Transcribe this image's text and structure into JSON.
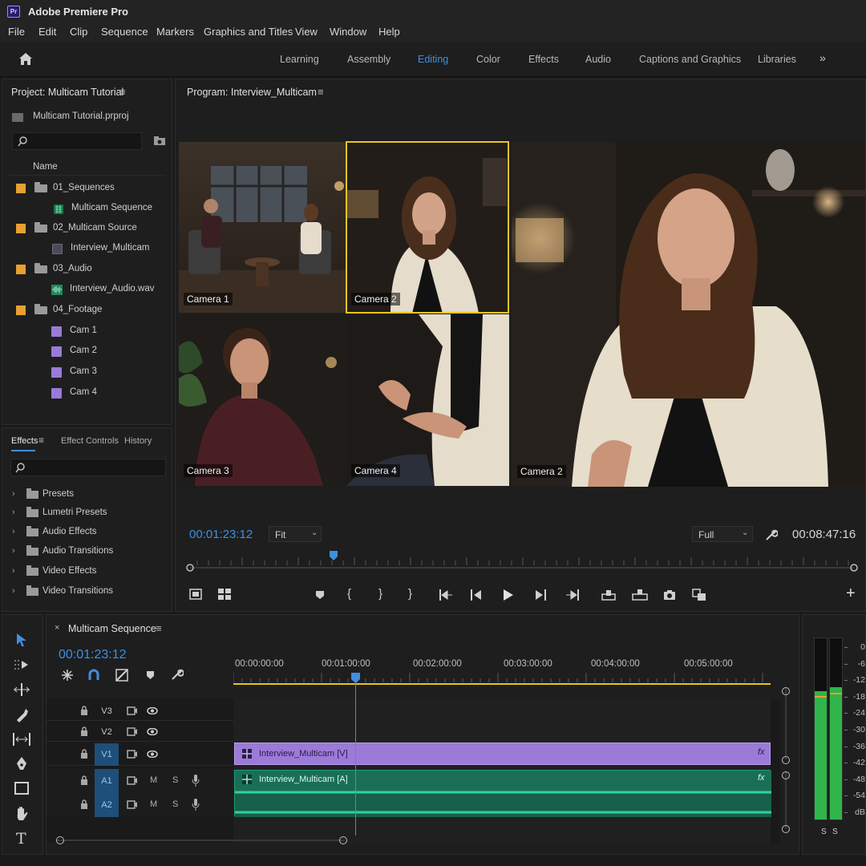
{
  "app": {
    "logo": "Pr",
    "title": "Adobe Premiere Pro"
  },
  "menu": [
    "File",
    "Edit",
    "Clip",
    "Sequence",
    "Markers",
    "Graphics and Titles",
    "View",
    "Window",
    "Help"
  ],
  "workspaces": {
    "items": [
      "Learning",
      "Assembly",
      "Editing",
      "Color",
      "Effects",
      "Audio",
      "Captions and Graphics",
      "Libraries"
    ],
    "active": "Editing",
    "more_icon": "double-chevron-right-icon"
  },
  "project": {
    "title": "Project: Multicam Tutorial",
    "file": "Multicam Tutorial.prproj",
    "column_name": "Name",
    "items": [
      {
        "label": "01_Sequences",
        "type": "folder",
        "color": "#e8a030"
      },
      {
        "label": "Multicam Sequence",
        "type": "sequence",
        "color": "#2fa86a"
      },
      {
        "label": "02_Multicam Source",
        "type": "folder",
        "color": "#e8a030"
      },
      {
        "label": "Interview_Multicam",
        "type": "multicam",
        "color": "#7a7a9a"
      },
      {
        "label": "03_Audio",
        "type": "folder",
        "color": "#e8a030"
      },
      {
        "label": "Interview_Audio.wav",
        "type": "audio",
        "color": "#2fa86a"
      },
      {
        "label": "04_Footage",
        "type": "folder",
        "color": "#e8a030"
      },
      {
        "label": "Cam 1",
        "type": "clip",
        "color": "#9a7ad8"
      },
      {
        "label": "Cam 2",
        "type": "clip",
        "color": "#9a7ad8"
      },
      {
        "label": "Cam 3",
        "type": "clip",
        "color": "#9a7ad8"
      },
      {
        "label": "Cam 4",
        "type": "clip",
        "color": "#9a7ad8"
      }
    ]
  },
  "effects_panel": {
    "tabs": [
      "Effects",
      "Effect Controls",
      "History"
    ],
    "active_tab": "Effects",
    "items": [
      "Presets",
      "Lumetri Presets",
      "Audio Effects",
      "Audio Transitions",
      "Video Effects",
      "Video Transitions"
    ]
  },
  "program": {
    "title": "Program: Interview_Multicam",
    "cameras": [
      "Camera 1",
      "Camera 2",
      "Camera 3",
      "Camera 4"
    ],
    "active_camera": "Camera 2",
    "preview_label": "Camera 2",
    "timecode_current": "00:01:23:12",
    "fit": "Fit",
    "resolution": "Full",
    "timecode_duration": "00:08:47:16",
    "playhead_fraction": 0.22
  },
  "timeline": {
    "tab_title": "Multicam Sequence",
    "timecode": "00:01:23:12",
    "ruler": [
      "00:00:00:00",
      "00:01:00:00",
      "00:02:00:00",
      "00:03:00:00",
      "00:04:00:00",
      "00:05:00:00"
    ],
    "video_tracks": [
      "V3",
      "V2",
      "V1"
    ],
    "audio_tracks": [
      "A1",
      "A2"
    ],
    "audio_flags": {
      "mute": "M",
      "solo": "S"
    },
    "video_clip": {
      "name": "Interview_Multicam [V]",
      "fx": "fx",
      "color": "#9b7ad8"
    },
    "audio_clip": {
      "name": "Interview_Multicam [A]",
      "fx": "fx",
      "color": "#1f9a78"
    }
  },
  "meters": {
    "scale": [
      "0",
      "-6",
      "-12",
      "-18",
      "-24",
      "-30",
      "-36",
      "-42",
      "-48",
      "-54",
      "dB"
    ],
    "solo_labels": [
      "S",
      "S"
    ],
    "left_level": 0.71,
    "right_level": 0.73
  }
}
